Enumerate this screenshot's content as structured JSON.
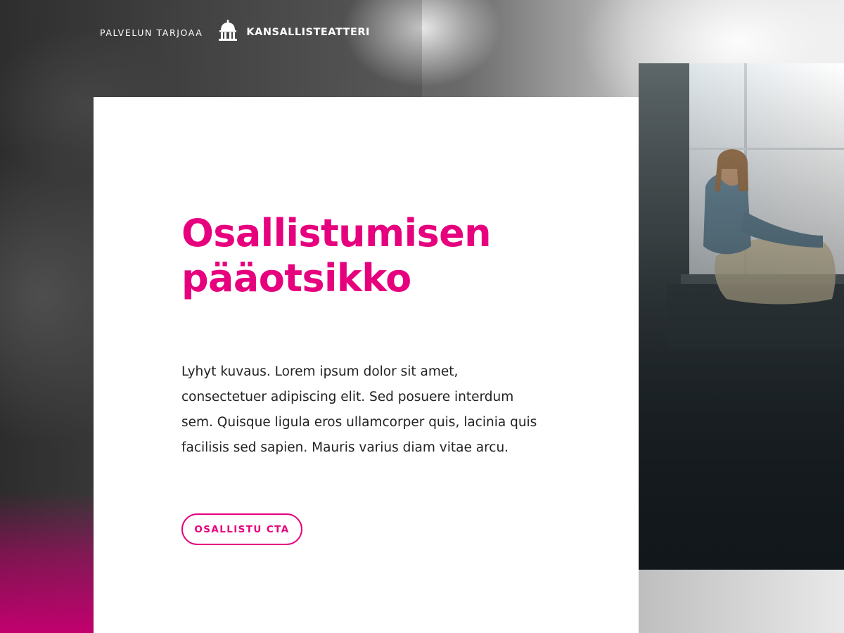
{
  "header": {
    "provider_label": "PALVELUN TARJOAA",
    "logo_icon": "theatre-building-icon",
    "logo_name": "KANSALLISTEATTERI"
  },
  "hero": {
    "title": "Osallistumisen pääotsikko",
    "description": "Lyhyt kuvaus. Lorem ipsum dolor sit amet, consectetuer adipiscing elit. Sed posuere interdum sem. Quisque ligula eros ullamcorper quis, lacinia quis facilisis sed sapien. Mauris varius diam vitae arcu.",
    "cta_label": "OSALLISTU CTA"
  },
  "colors": {
    "accent": "#e6007e",
    "card_background": "#ffffff",
    "text": "#222222"
  }
}
